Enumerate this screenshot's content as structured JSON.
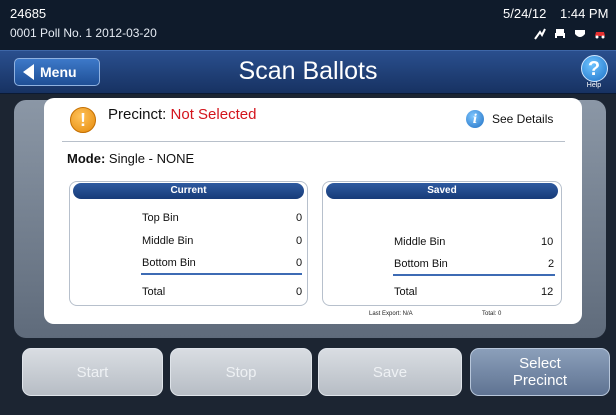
{
  "status": {
    "id": "24685",
    "poll": "0001 Poll No. 1  2012-03-20",
    "date": "5/24/12",
    "time": "1:44 PM",
    "icons": [
      "signal-icon",
      "printer-icon",
      "shield-icon",
      "car-icon"
    ]
  },
  "titlebar": {
    "menu_label": "Menu",
    "title": "Scan Ballots",
    "help_label": "Help"
  },
  "precinct": {
    "label": "Precinct: ",
    "value": "Not Selected",
    "details_label": "See Details"
  },
  "mode": {
    "label": "Mode:",
    "value": " Single - NONE"
  },
  "current": {
    "heading": "Current",
    "rows": [
      {
        "label": "Top Bin",
        "value": "0"
      },
      {
        "label": "Middle Bin",
        "value": "0"
      },
      {
        "label": "Bottom Bin",
        "value": "0"
      }
    ],
    "total_label": "Total",
    "total_value": "0"
  },
  "saved": {
    "heading": "Saved",
    "rows": [
      {
        "label": "Middle Bin",
        "value": "10"
      },
      {
        "label": "Bottom Bin",
        "value": "2"
      }
    ],
    "total_label": "Total",
    "total_value": "12",
    "last_export": "Last Export: N/A",
    "total_footnote": "Total: 0"
  },
  "buttons": {
    "start": "Start",
    "stop": "Stop",
    "save": "Save",
    "select_line1": "Select",
    "select_line2": "Precinct"
  },
  "colors": {
    "accent": "#1f4f96",
    "warning": "#e58a0b",
    "alert_text": "#d3141c"
  }
}
